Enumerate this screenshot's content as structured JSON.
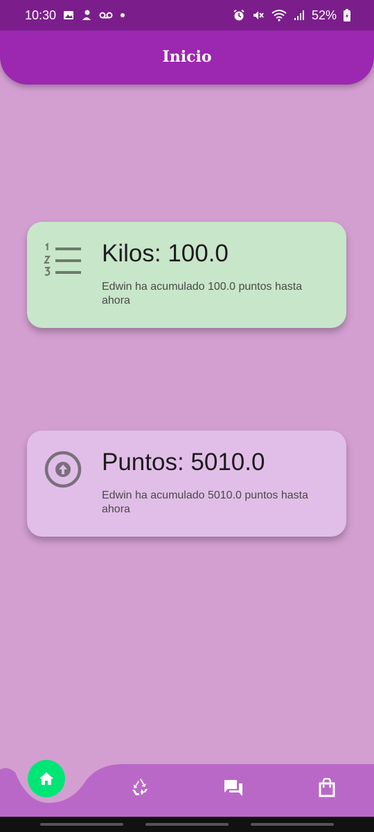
{
  "status_bar": {
    "time": "10:30",
    "battery": "52%"
  },
  "app_bar": {
    "title": "Inicio"
  },
  "cards": [
    {
      "title": "Kilos: 100.0",
      "subtitle": "Edwin ha acumulado 100.0 puntos hasta ahora",
      "icon": "format-list-numbered-icon",
      "color": "#c8e6c9"
    },
    {
      "title": "Puntos: 5010.0",
      "subtitle": "Edwin ha acumulado 5010.0 puntos hasta ahora",
      "icon": "arrow-circle-up-icon",
      "color": "#e1bee7"
    }
  ],
  "bottom_nav": {
    "items": [
      "home-icon",
      "recycle-icon",
      "chat-icon",
      "shopping-bag-icon"
    ],
    "active": "home-icon",
    "active_color": "#00e676",
    "bar_color": "#ba68c8"
  },
  "colors": {
    "background": "#d39fd1",
    "app_bar": "#9c27b0",
    "status_bar": "#7b1e8c"
  }
}
